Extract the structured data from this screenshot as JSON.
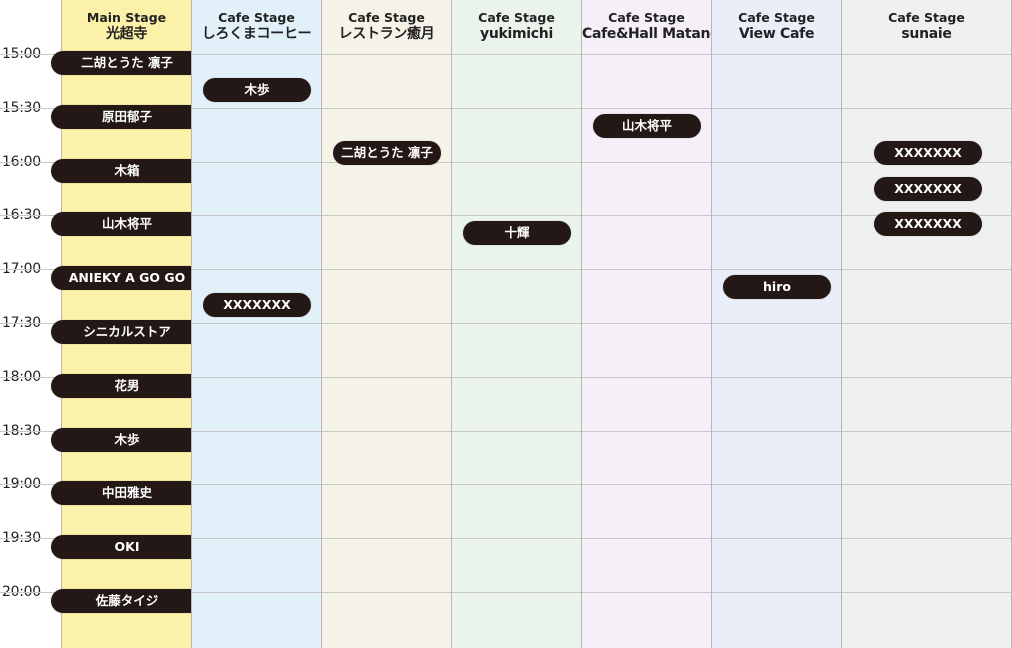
{
  "time_labels": [
    "15:00",
    "15:30",
    "16:00",
    "16:30",
    "17:00",
    "17:30",
    "18:00",
    "18:30",
    "19:00",
    "19:30",
    "20:00"
  ],
  "stages": [
    {
      "type": "Main Stage",
      "name": "光超寺",
      "color": "#fbf1a9",
      "slots": [
        {
          "label": "二胡とうた 凛子",
          "start": "15:05"
        },
        {
          "label": "原田郁子",
          "start": "15:35"
        },
        {
          "label": "木箱",
          "start": "16:05"
        },
        {
          "label": "山木将平",
          "start": "16:35"
        },
        {
          "label": "ANIEKY A GO GO",
          "start": "17:05"
        },
        {
          "label": "シニカルストア",
          "start": "17:35"
        },
        {
          "label": "花男",
          "start": "18:05"
        },
        {
          "label": "木歩",
          "start": "18:35"
        },
        {
          "label": "中田雅史",
          "start": "19:05"
        },
        {
          "label": "OKI",
          "start": "19:35"
        },
        {
          "label": "佐藤タイジ",
          "start": "20:05"
        }
      ]
    },
    {
      "type": "Cafe Stage",
      "name": "しろくまコーヒー",
      "color": "#e2f0fa",
      "slots": [
        {
          "label": "木歩",
          "start": "15:20"
        },
        {
          "label": "XXXXXXX",
          "start": "17:20"
        }
      ]
    },
    {
      "type": "Cafe Stage",
      "name": "レストラン癒月",
      "color": "#f5f2e8",
      "slots": [
        {
          "label": "二胡とうた 凛子",
          "start": "15:55"
        }
      ]
    },
    {
      "type": "Cafe Stage",
      "name": "yukimichi",
      "color": "#eaf3ec",
      "slots": [
        {
          "label": "十輝",
          "start": "16:40"
        }
      ]
    },
    {
      "type": "Cafe Stage",
      "name": "Cafe&Hall Matano",
      "color": "#f5f0f7",
      "slots": [
        {
          "label": "山木将平",
          "start": "15:40"
        }
      ]
    },
    {
      "type": "Cafe Stage",
      "name": "View Cafe",
      "color": "#e9eef9",
      "slots": [
        {
          "label": "hiro",
          "start": "17:10"
        }
      ]
    },
    {
      "type": "Cafe Stage",
      "name": "sunaie",
      "color": "#eff0f0",
      "slots": [
        {
          "label": "XXXXXXX",
          "start": "15:55"
        },
        {
          "label": "XXXXXXX",
          "start": "16:15"
        },
        {
          "label": "XXXXXXX",
          "start": "16:35"
        }
      ]
    }
  ]
}
